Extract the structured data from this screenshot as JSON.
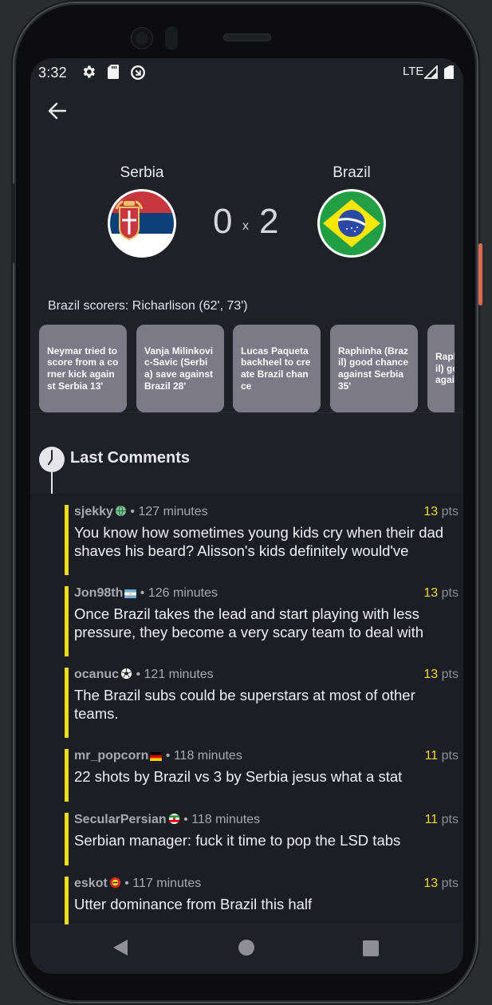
{
  "status_bar": {
    "time": "3:32",
    "network": "LTE"
  },
  "match": {
    "home": {
      "name": "Serbia",
      "score": "0"
    },
    "away": {
      "name": "Brazil",
      "score": "2"
    },
    "separator": "x",
    "scorers": "Brazil scorers: Richarlison (62', 73')"
  },
  "highlights": [
    "Neymar tried to score from a corner kick against Serbia 13'",
    "Vanja Milinkovic-Savic (Serbia) save against Brazil 28'",
    "Lucas Paqueta backheel to create Brazil chance",
    "Raphinha (Brazil) good chance against Serbia 35'",
    "Raphinha (Brazil) good chance against Serbia"
  ],
  "comments_section": {
    "title": "Last Comments"
  },
  "comments": [
    {
      "user": "sjekky",
      "badge": "globe-badge",
      "time": "127 minutes",
      "points": "13",
      "pts_label": "pts",
      "text": "You know how sometimes young kids cry when their dad shaves his beard? Alisson's kids definitely would've"
    },
    {
      "user": "Jon98th",
      "badge": "argentina-flag",
      "time": "126 minutes",
      "points": "13",
      "pts_label": "pts",
      "text": "Once Brazil takes the lead and start playing with less pressure, they become a very scary team to deal with"
    },
    {
      "user": "ocanuc",
      "badge": "soccer-ball",
      "time": "121 minutes",
      "points": "13",
      "pts_label": "pts",
      "text": "The Brazil subs could be superstars at most of other teams."
    },
    {
      "user": "mr_popcorn",
      "badge": "germany-flag",
      "time": "118 minutes",
      "points": "11",
      "pts_label": "pts",
      "text": "22 shots by Brazil vs 3 by Serbia jesus what a stat"
    },
    {
      "user": "SecularPersian",
      "badge": "iran-badge",
      "time": "118 minutes",
      "points": "11",
      "pts_label": "pts",
      "text": "Serbian manager: fuck it time to pop the LSD tabs"
    },
    {
      "user": "eskot",
      "badge": "manutd-badge",
      "time": "117 minutes",
      "points": "13",
      "pts_label": "pts",
      "text": "Utter dominance from Brazil this half"
    }
  ],
  "colors": {
    "accent": "#f2dc1c",
    "background": "#202027",
    "card": "#7d7a88"
  }
}
